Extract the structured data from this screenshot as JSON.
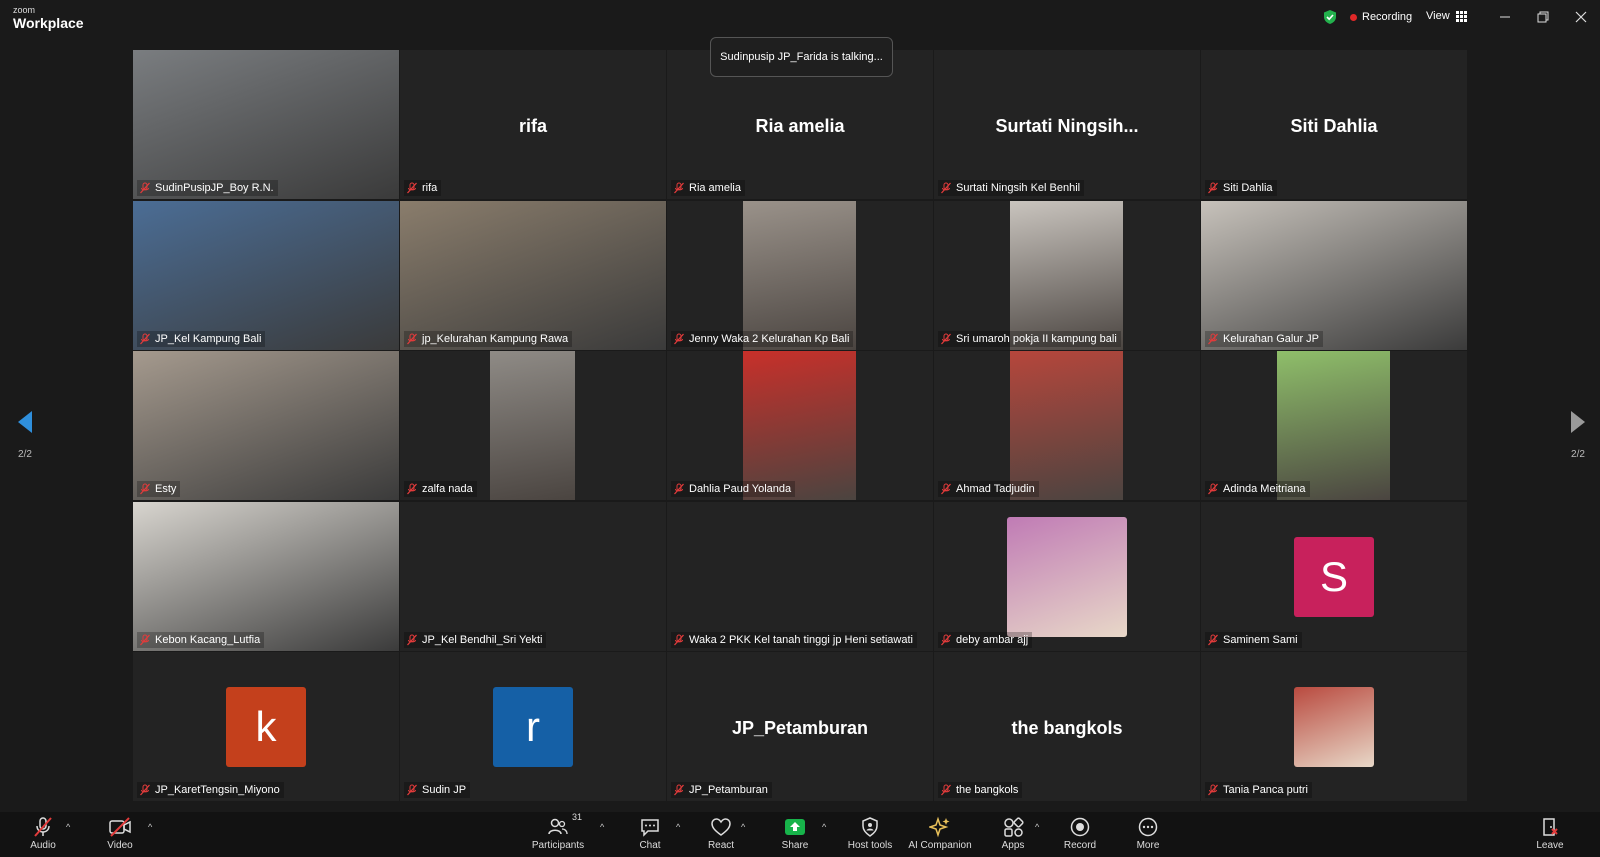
{
  "titlebar": {
    "brand_small": "zoom",
    "brand_big": "Workplace",
    "recording": "Recording",
    "view": "View"
  },
  "toast": "Sudinpusip JP_Farida is talking...",
  "page_indicator": {
    "left": "2/2",
    "right": "2/2"
  },
  "tiles": [
    {
      "label": "SudinPusipJP_Boy R.N.",
      "center": "",
      "type": "video",
      "bg": "#7a7d80"
    },
    {
      "label": "rifa",
      "center": "rifa",
      "type": "name"
    },
    {
      "label": "Ria amelia",
      "center": "Ria amelia",
      "type": "name"
    },
    {
      "label": "Surtati Ningsih Kel Benhil",
      "center": "Surtati  Ningsih...",
      "type": "name"
    },
    {
      "label": "Siti Dahlia",
      "center": "Siti Dahlia",
      "type": "name"
    },
    {
      "label": "JP_Kel Kampung Bali",
      "center": "",
      "type": "video",
      "bg": "#4b6d95"
    },
    {
      "label": "jp_Kelurahan Kampung Rawa",
      "center": "",
      "type": "video",
      "bg": "#8a7d6c"
    },
    {
      "label": "Jenny Waka 2 Kelurahan Kp Bali",
      "center": "",
      "type": "video-narrow",
      "bg": "#9a928a"
    },
    {
      "label": "Sri umaroh pokja II kampung bali",
      "center": "",
      "type": "video-narrow",
      "bg": "#c9c4be"
    },
    {
      "label": "Kelurahan Galur JP",
      "center": "",
      "type": "video",
      "bg": "#c7c2bb"
    },
    {
      "label": "Esty",
      "center": "",
      "type": "video",
      "bg": "#a59a8e"
    },
    {
      "label": "zalfa nada",
      "center": "",
      "type": "video-slim",
      "bg": "#8f8b86"
    },
    {
      "label": "Dahlia Paud Yolanda",
      "center": "",
      "type": "video-narrow",
      "bg": "#c8302a"
    },
    {
      "label": "Ahmad Tadjudin",
      "center": "",
      "type": "video-narrow",
      "bg": "#b6463c"
    },
    {
      "label": "Adinda Meitriana",
      "center": "",
      "type": "video-narrow",
      "bg": "#8fbf6a"
    },
    {
      "label": "Kebon Kacang_Lutfia",
      "center": "",
      "type": "video",
      "bg": "#d8d5cf"
    },
    {
      "label": "JP_Kel Bendhil_Sri Yekti",
      "center": "",
      "type": "blank"
    },
    {
      "label": "Waka 2 PKK Kel tanah tinggi jp Heni setiawati",
      "center": "",
      "type": "blank"
    },
    {
      "label": "deby ambar ajj",
      "center": "",
      "type": "photo",
      "bg": "#c07bb5"
    },
    {
      "label": "Saminem Sami",
      "center": "",
      "type": "avatar",
      "letter": "S",
      "bg": "#c8215c"
    },
    {
      "label": "JP_KaretTengsin_Miyono",
      "center": "",
      "type": "avatar",
      "letter": "k",
      "bg": "#c4401c"
    },
    {
      "label": "Sudin JP",
      "center": "",
      "type": "avatar",
      "letter": "r",
      "bg": "#1560a6"
    },
    {
      "label": "JP_Petamburan",
      "center": "JP_Petamburan",
      "type": "name"
    },
    {
      "label": "the bangkols",
      "center": "the bangkols",
      "type": "name"
    },
    {
      "label": "Tania Panca putri",
      "center": "",
      "type": "photo",
      "bg": "#b94a3f"
    }
  ],
  "toolbar": {
    "audio": "Audio",
    "video": "Video",
    "participants": "Participants",
    "participants_count": "31",
    "chat": "Chat",
    "react": "React",
    "share": "Share",
    "host_tools": "Host tools",
    "ai_companion": "AI Companion",
    "apps": "Apps",
    "record": "Record",
    "more": "More",
    "leave": "Leave"
  }
}
